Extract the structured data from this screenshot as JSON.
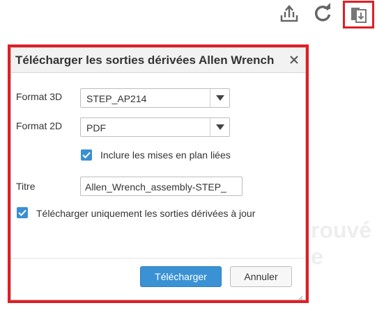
{
  "toolbar": {
    "upload_icon": "upload-icon",
    "refresh_icon": "refresh-icon",
    "derived_outputs_icon": "derived-outputs-download-icon"
  },
  "background": {
    "text_line1": "rouvé",
    "text_line2": "e"
  },
  "dialog": {
    "title": "Télécharger les sorties dérivées Allen Wrench",
    "close_label": "×",
    "format3d_label": "Format 3D",
    "format3d_value": "STEP_AP214",
    "format2d_label": "Format 2D",
    "format2d_value": "PDF",
    "include_drawings_label": "Inclure les mises en plan liées",
    "include_drawings_checked": true,
    "title_label": "Titre",
    "title_value": "Allen_Wrench_assembly-STEP_",
    "uptodate_label": "Télécharger uniquement les sorties dérivées à jour",
    "uptodate_checked": true,
    "download_button": "Télécharger",
    "cancel_button": "Annuler"
  },
  "colors": {
    "highlight": "#e01e24",
    "primary": "#3a92d4",
    "checkbox": "#3a8fd2"
  }
}
